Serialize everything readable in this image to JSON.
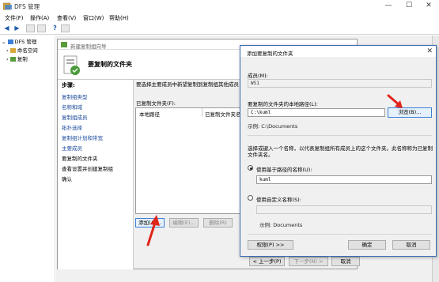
{
  "window": {
    "title": "DFS 管理",
    "controls": {
      "minimize": "—",
      "maximize": "☐",
      "close": "✕"
    }
  },
  "menubar": [
    "文件(F)",
    "操作(A)",
    "查看(V)",
    "窗口(W)",
    "帮助(H)"
  ],
  "tree": {
    "root": "DFS 管理",
    "children": [
      "命名空间",
      "复制"
    ]
  },
  "wizard": {
    "title": "新建复制组向导",
    "heading": "要复制的文件夹",
    "steps_heading": "步骤:",
    "steps": [
      "复制组类型",
      "名称和域",
      "复制组成员",
      "拓扑选择",
      "复制组计划和带宽",
      "主要成员",
      "要复制的文件夹",
      "查看设置并创建复制组",
      "确认"
    ],
    "current_step": 6,
    "description": "要选择主要成员中新望复制到复制组其他成员",
    "list_label": "已复制文件夹(F):",
    "columns": [
      "本地路径",
      "已复制文件夹名"
    ],
    "buttons": {
      "add": "添加(A)...",
      "edit": "编辑(E)...",
      "delete": "删除(R)"
    },
    "nav": {
      "back": "< 上一步(P)",
      "next": "下一步(N) >",
      "cancel": "取消"
    }
  },
  "dialog": {
    "title": "添加要复制的文件夹",
    "member_label": "成员(M):",
    "member_value": "WS1",
    "path_label": "要复制的文件夹的本地路径(L):",
    "path_value": "C:\\kuml",
    "browse": "浏览(B)...",
    "path_example": "示例:  C:\\Documents",
    "info_text": "选择或键入一个名称，以代表复制组所有成员上的这个文件夹。此名称称为已复制文件夹名。",
    "radio_path_name": "使用基于路径的名称(U):",
    "path_name_value": "kuml",
    "radio_custom_name": "使用自定义名称(S):",
    "custom_example": "示例:  Documents",
    "selected_radio": "path",
    "permissions": "权限(P) >>",
    "ok": "确定",
    "cancel": "取消"
  },
  "colors": {
    "link": "#1a4a9c",
    "dialog_border": "#3b6bb5",
    "annotation_arrow": "#e0261b"
  }
}
